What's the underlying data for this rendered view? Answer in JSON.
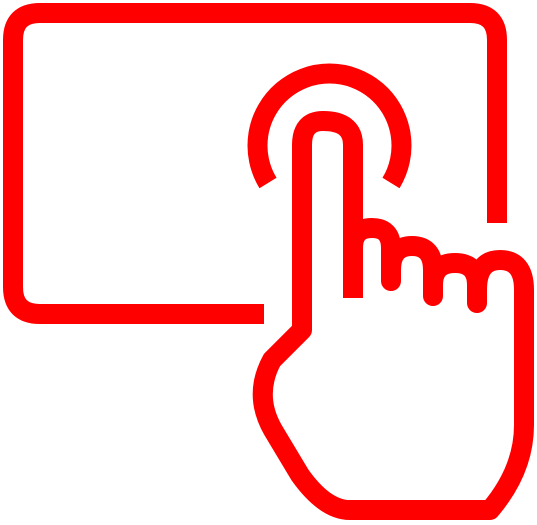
{
  "icon": {
    "name": "touch-screen-tap-icon",
    "parts": [
      "screen-frame-icon",
      "tap-ripple-icon",
      "pointing-hand-icon"
    ]
  },
  "colors": {
    "stroke": "#ff0000",
    "background": "#ffffff"
  }
}
